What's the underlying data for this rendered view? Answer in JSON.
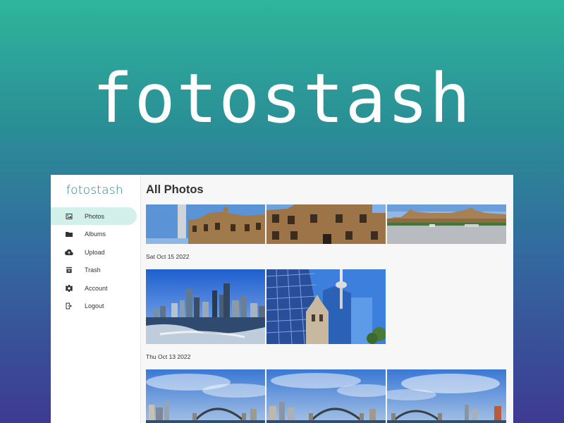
{
  "hero": {
    "title": "fotostash"
  },
  "app": {
    "brand": "fotostash",
    "nav": [
      {
        "label": "Photos",
        "icon": "image-icon",
        "active": true
      },
      {
        "label": "Albums",
        "icon": "folder-icon",
        "active": false
      },
      {
        "label": "Upload",
        "icon": "cloud-upload-icon",
        "active": false
      },
      {
        "label": "Trash",
        "icon": "trash-icon",
        "active": false
      },
      {
        "label": "Account",
        "icon": "gear-icon",
        "active": false
      },
      {
        "label": "Logout",
        "icon": "logout-icon",
        "active": false
      }
    ],
    "page_title": "All Photos",
    "groups": [
      {
        "date": "Sat Oct 15 2022"
      },
      {
        "date": "Thu Oct 13 2022"
      }
    ]
  },
  "colors": {
    "accent": "#2e7d86",
    "active_bg": "#d3f0ea"
  }
}
